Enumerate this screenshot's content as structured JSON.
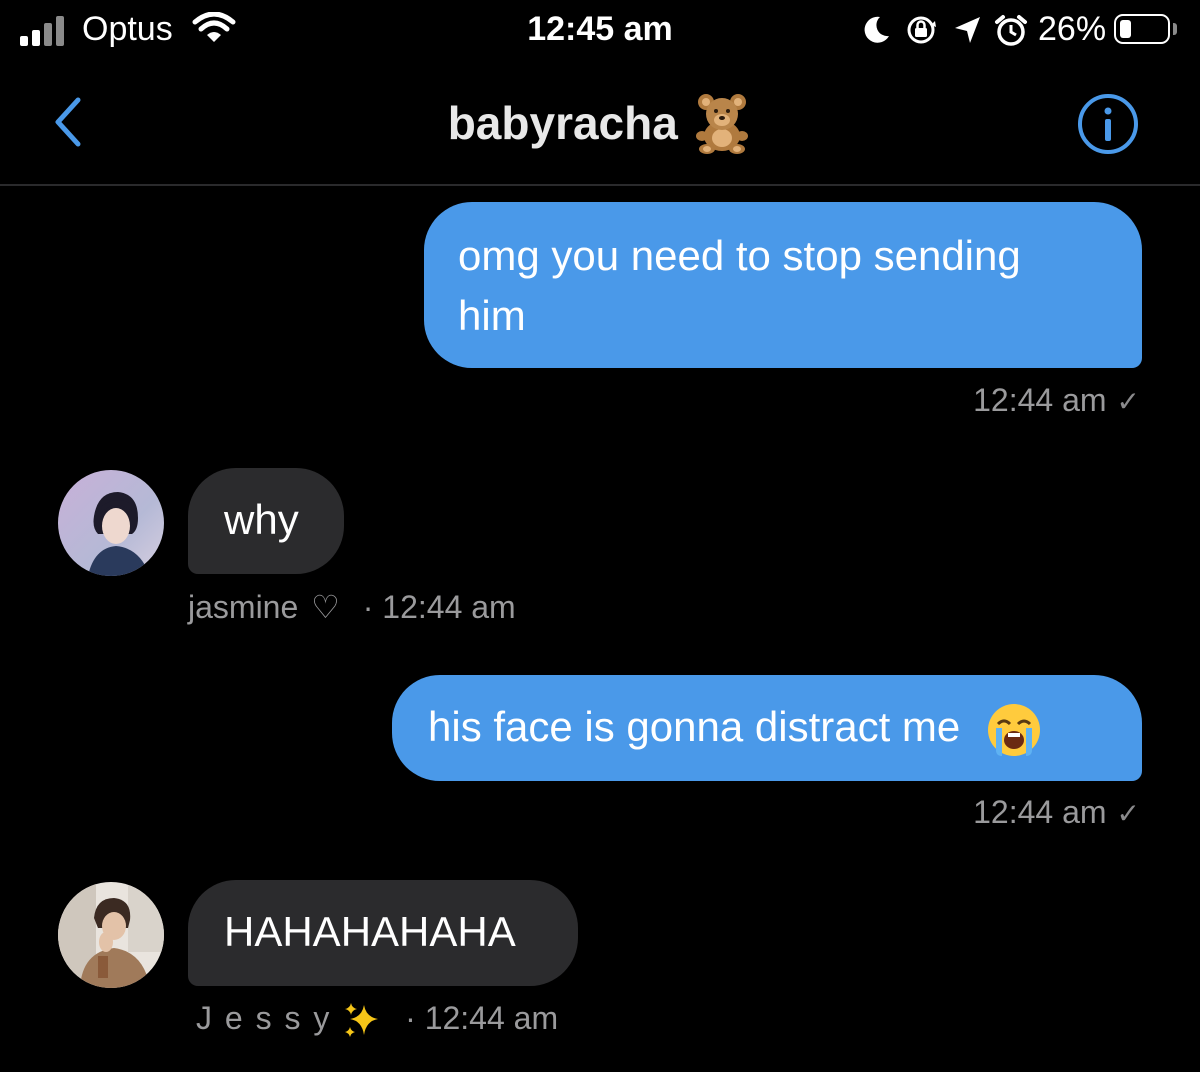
{
  "status_bar": {
    "carrier": "Optus",
    "time": "12:45 am",
    "battery_percent": "26%",
    "battery_level": 0.26,
    "icons": [
      "signal-icon",
      "wifi-icon",
      "moon-icon",
      "rotation-lock-icon",
      "location-arrow-icon",
      "alarm-icon",
      "battery-icon"
    ]
  },
  "header": {
    "title": "babyracha",
    "title_emoji": "teddy-bear-emoji",
    "back_icon": "chevron-left-icon",
    "info_icon": "info-circle-icon"
  },
  "colors": {
    "accent": "#4a99e9",
    "incoming_bubble": "#2b2b2d",
    "background": "#000000",
    "meta_text": "#9a9a9c"
  },
  "messages": [
    {
      "direction": "outgoing",
      "lines": [
        "omg you need to stop sending",
        "him"
      ],
      "time": "12:44 am",
      "status": "✓"
    },
    {
      "direction": "incoming",
      "text": "why",
      "sender": "jasmine",
      "sender_suffix": "♡",
      "time": "· 12:44 am"
    },
    {
      "direction": "outgoing",
      "text": "his face is gonna distract me",
      "emoji": "loudly-crying-face-emoji",
      "time": "12:44 am",
      "status": "✓"
    },
    {
      "direction": "incoming",
      "text": "HAHAHAHAHA",
      "sender": "J e s s y",
      "sender_emoji": "sparkles-emoji",
      "time": "· 12:44 am"
    }
  ]
}
